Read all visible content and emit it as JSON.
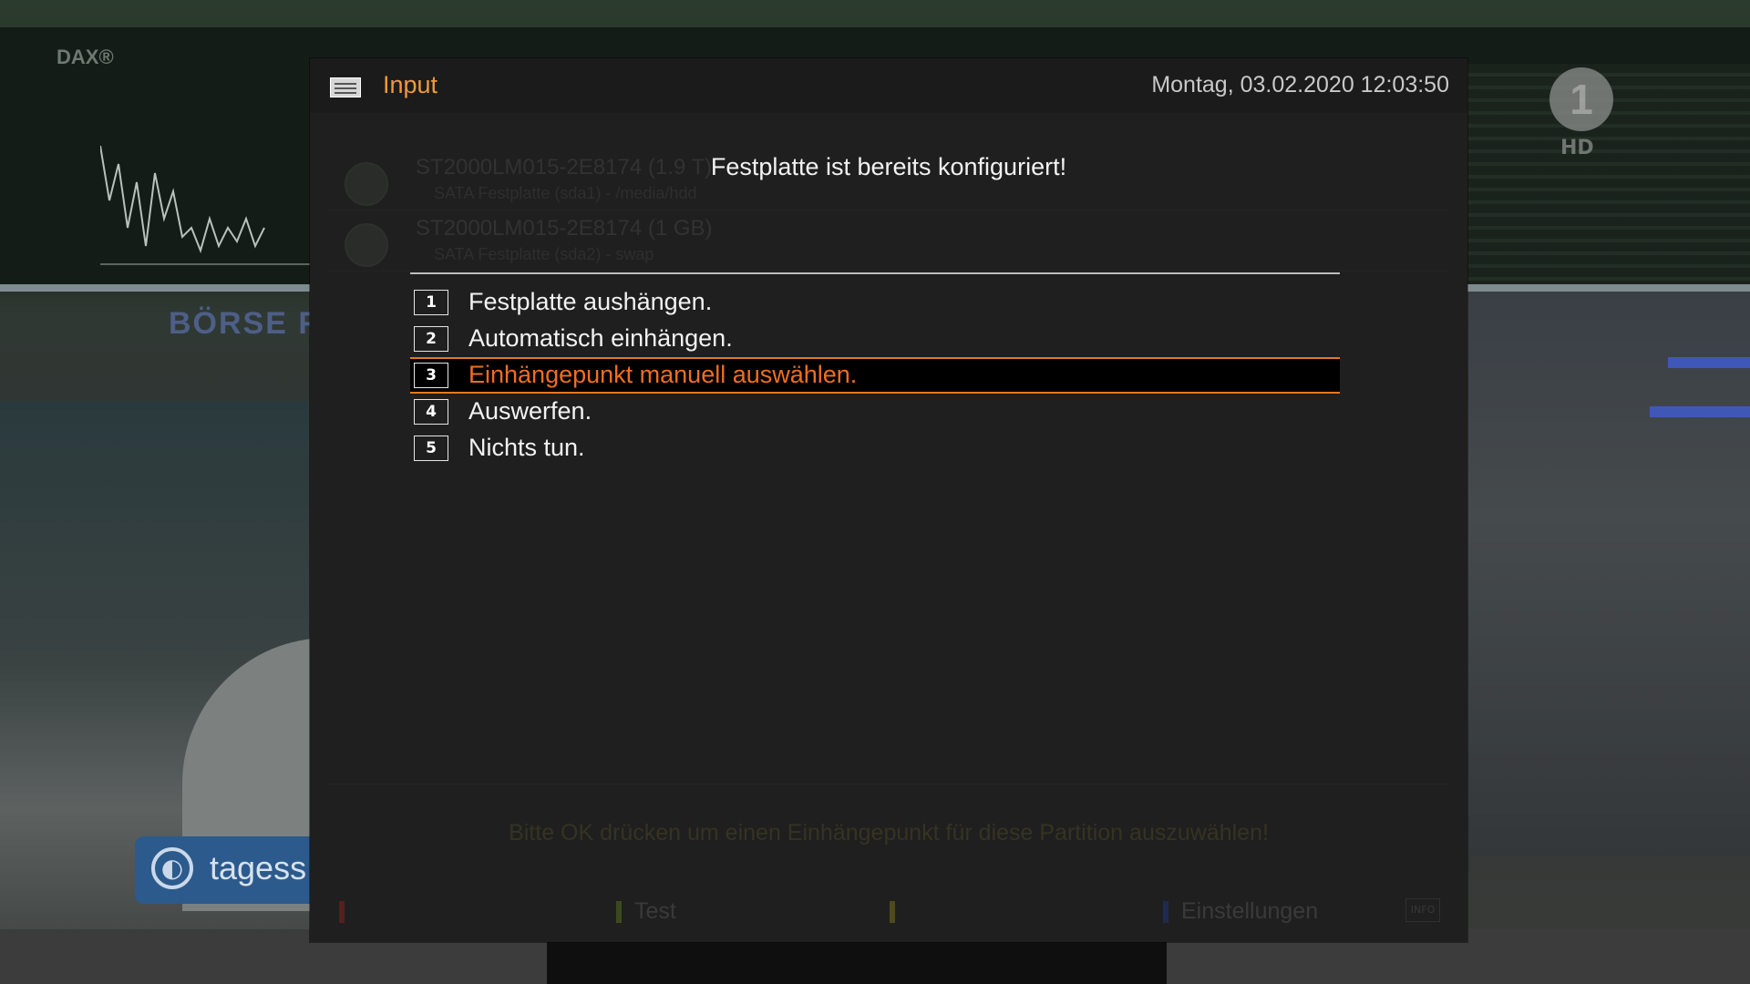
{
  "background": {
    "dax_label": "DAX®",
    "boerse_label": "BÖRSE F",
    "tagesschau_label": "tagess",
    "channel_logo": "1",
    "channel_hd": "HD"
  },
  "window": {
    "title": "Input",
    "title_icon": "input-icon",
    "datetime": "Montag, 03.02.2020  12:03:50"
  },
  "device_list": [
    {
      "name": "ST2000LM015-2E8174 (1.9 T)",
      "detail": "SATA Festplatte (sda1) - /media/hdd",
      "icon": "hdd-icon"
    },
    {
      "name": "ST2000LM015-2E8174 (1 GB)",
      "detail": "SATA Festplatte (sda2) - swap",
      "icon": "hdd-icon"
    }
  ],
  "dialog": {
    "message": "Festplatte ist bereits konfiguriert!",
    "options": [
      {
        "key": "1",
        "label": "Festplatte aushängen."
      },
      {
        "key": "2",
        "label": "Automatisch einhängen."
      },
      {
        "key": "3",
        "label": "Einhängepunkt manuell auswählen.",
        "selected": true
      },
      {
        "key": "4",
        "label": "Auswerfen."
      },
      {
        "key": "5",
        "label": "Nichts tun."
      }
    ],
    "selected_index": 2
  },
  "footer": {
    "hint": "Bitte OK drücken um einen Einhängepunkt für diese Partition auszuwählen!",
    "buttons": [
      {
        "color": "red",
        "label": ""
      },
      {
        "color": "green",
        "label": "Test"
      },
      {
        "color": "yellow",
        "label": ""
      },
      {
        "color": "blue",
        "label": "Einstellungen"
      }
    ],
    "info_label": "INFO"
  },
  "colors": {
    "accent": "#f09a38",
    "selected_text": "#f06e1e",
    "selection_border": "#e8781e",
    "window_bg": "#1f1f1f",
    "red": "#5a1d1d",
    "green": "#3b4a1f",
    "yellow": "#4e4a1c",
    "blue": "#1f2b4e"
  }
}
